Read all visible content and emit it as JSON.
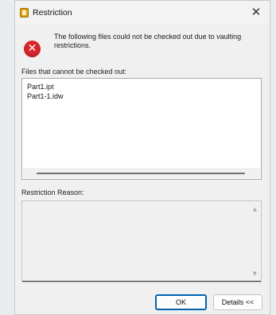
{
  "window": {
    "title": "Restriction",
    "close_glyph": "✕"
  },
  "message": {
    "icon": "error-icon",
    "text": "The following files could not be checked out due to vaulting restrictions."
  },
  "files_label": "Files that cannot be checked out:",
  "files": [
    "Part1.ipt",
    "Part1-1.idw"
  ],
  "reason_label": "Restriction Reason:",
  "reason_text": "",
  "buttons": {
    "ok": "OK",
    "details": "Details <<"
  },
  "colors": {
    "error": "#d6262a",
    "default_button_border": "#0063b1"
  }
}
